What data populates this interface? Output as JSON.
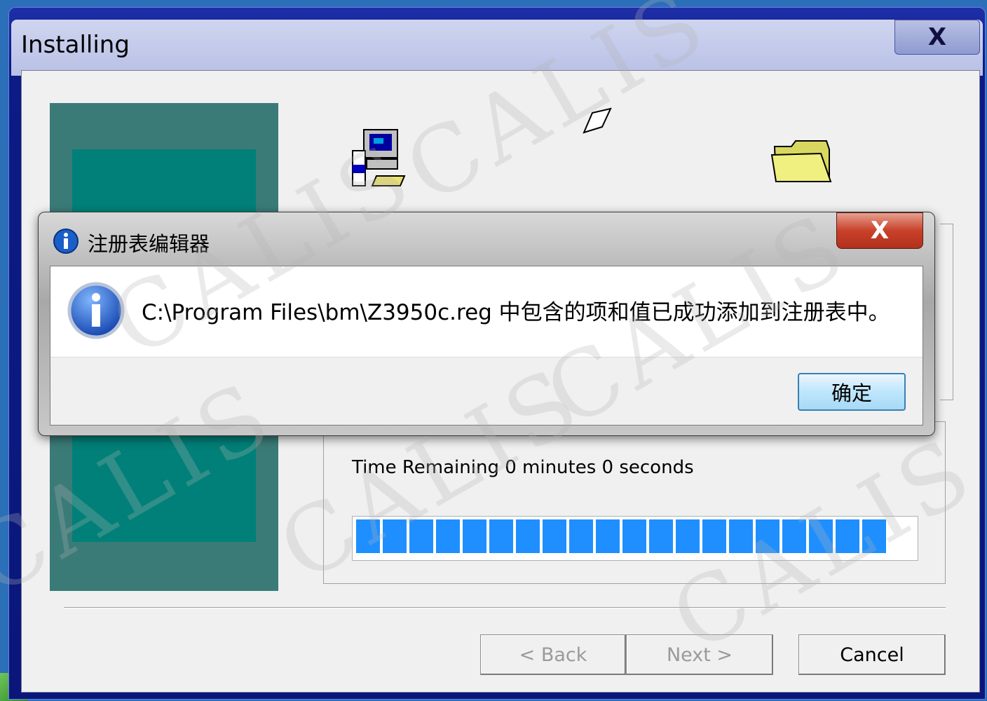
{
  "installer": {
    "title": "Installing",
    "close_glyph": "X",
    "time_remaining": "Time Remaining 0 minutes 0 seconds",
    "progress_percent": 96,
    "progress_segments_filled": 20,
    "buttons": {
      "back": "< Back",
      "next": "Next >",
      "cancel": "Cancel"
    },
    "icons": [
      "computer-setup-icon",
      "paper-icon",
      "folder-icon"
    ]
  },
  "dialog": {
    "title": "注册表编辑器",
    "close_glyph": "X",
    "message": "C:\\Program Files\\bm\\Z3950c.reg 中包含的项和值已成功添加到注册表中。",
    "ok_label": "确定",
    "icon": "info-icon"
  },
  "watermark": "CALIS",
  "colors": {
    "progress": "#1f8fff",
    "side_panel": "#3a7b78",
    "side_inner": "#008078",
    "titlebar": "#0c1b86"
  }
}
